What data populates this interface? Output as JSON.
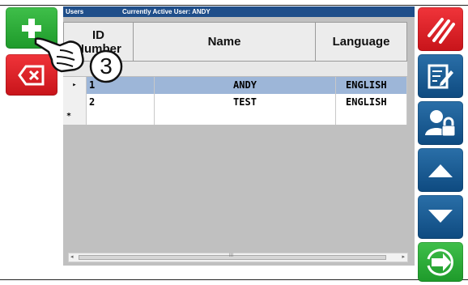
{
  "titlebar": {
    "section": "Users",
    "active_user": "Currently Active User: ANDY"
  },
  "columns": {
    "id": "ID\nNumber",
    "name": "Name",
    "language": "Language"
  },
  "rows": [
    {
      "indicator": "▸",
      "id": "1",
      "name": "ANDY",
      "language": "ENGLISH",
      "selected": true
    },
    {
      "indicator": "",
      "id": "2",
      "name": "TEST",
      "language": "ENGLISH",
      "selected": false
    },
    {
      "indicator": "*",
      "id": "",
      "name": "",
      "language": "",
      "selected": false
    }
  ],
  "callout": {
    "step_number": "3"
  },
  "scrollbar": {
    "thumb_glyph": "III"
  },
  "icons": {
    "left": [
      "plus-icon",
      "backspace-icon"
    ],
    "right": [
      "cancel-slash-icon",
      "edit-icon",
      "user-lock-icon",
      "arrow-up-icon",
      "arrow-down-icon",
      "enter-icon"
    ]
  },
  "colors": {
    "selected_row": "#9db6d8",
    "titlebar": "#1f4e8a",
    "green": "#28a836",
    "red": "#e0252b",
    "blue": "#1a5a92"
  }
}
